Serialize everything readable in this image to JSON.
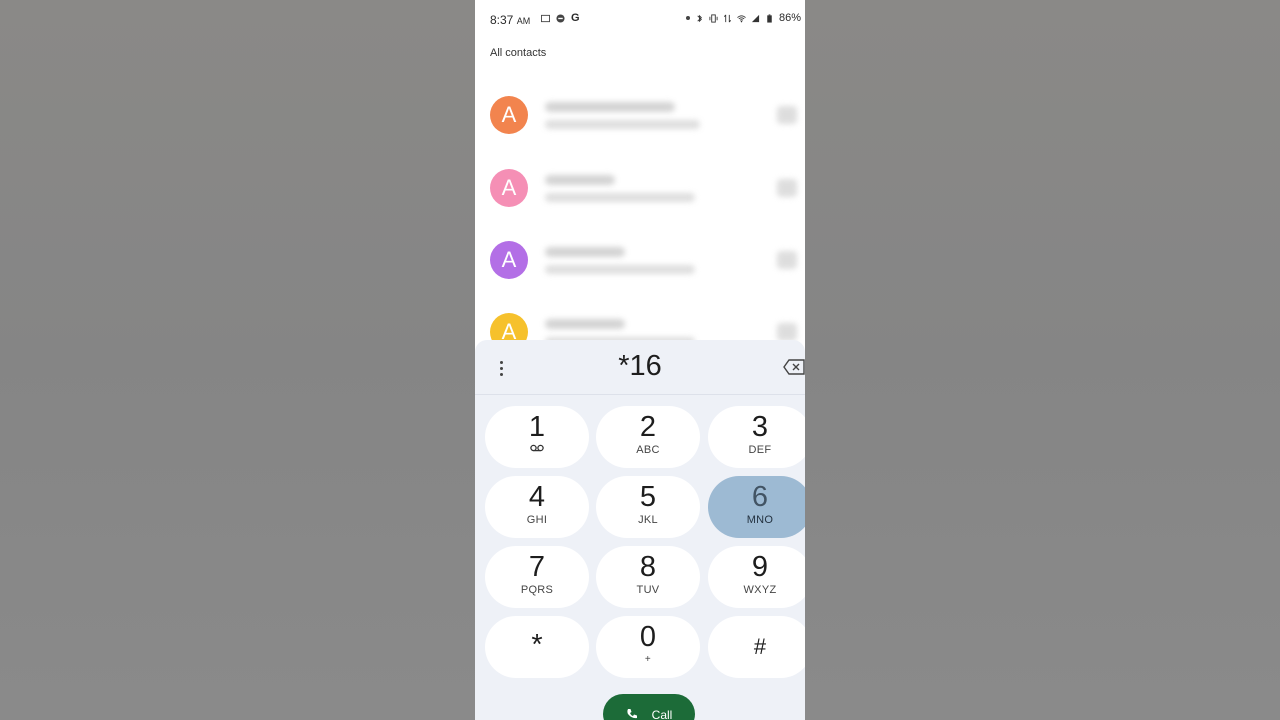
{
  "status_bar": {
    "time": "8:37",
    "ampm": "AM",
    "g_label": "G",
    "battery": "86%"
  },
  "contacts": {
    "section_label": "All contacts",
    "items": [
      {
        "initial": "A",
        "color": "#f2844e"
      },
      {
        "initial": "A",
        "color": "#f58fb5"
      },
      {
        "initial": "A",
        "color": "#b36fe6"
      },
      {
        "initial": "A",
        "color": "#f6c12c"
      }
    ]
  },
  "dialpad": {
    "number": "*16",
    "keys": [
      {
        "digit": "1",
        "letters": ""
      },
      {
        "digit": "2",
        "letters": "ABC"
      },
      {
        "digit": "3",
        "letters": "DEF"
      },
      {
        "digit": "4",
        "letters": "GHI"
      },
      {
        "digit": "5",
        "letters": "JKL"
      },
      {
        "digit": "6",
        "letters": "MNO"
      },
      {
        "digit": "7",
        "letters": "PQRS"
      },
      {
        "digit": "8",
        "letters": "TUV"
      },
      {
        "digit": "9",
        "letters": "WXYZ"
      },
      {
        "digit": "*",
        "letters": ""
      },
      {
        "digit": "0",
        "letters": "+"
      },
      {
        "digit": "#",
        "letters": ""
      }
    ],
    "call_label": "Call",
    "accent": "#1c6b38",
    "pressed_key_color": "#9dbad3"
  }
}
